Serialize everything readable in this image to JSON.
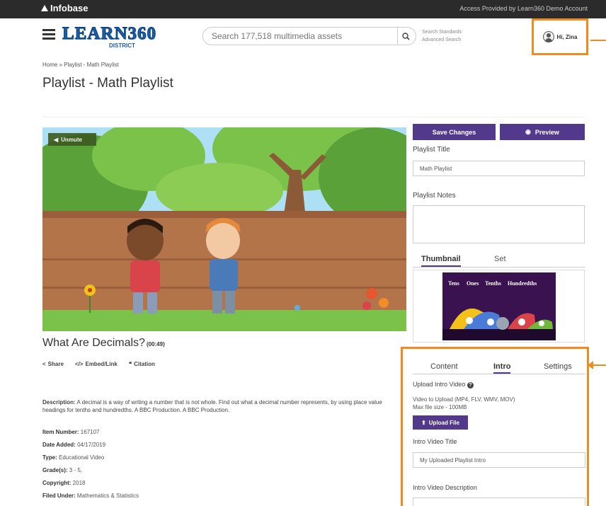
{
  "topbar": {
    "brand": "Infobase",
    "access": "Access Provided by Learn360 Demo Account"
  },
  "header": {
    "logo_word": "LEARN360",
    "logo_sub": "DISTRICT",
    "search_placeholder": "Search 177,518 multimedia assets",
    "standards_link": "Search Standards",
    "advanced_link": "Advanced Search",
    "greeting": "Hi, Zina"
  },
  "breadcrumb": "Home » Playlist - Math Playlist",
  "page_title": "Playlist - Math Playlist",
  "video": {
    "unmute_label": "Unmute",
    "title": "What Are Decimals?",
    "duration": "(00:49)",
    "actions": {
      "share": "Share",
      "embed": "Embed/Link",
      "citation": "Citation"
    }
  },
  "description": {
    "label": "Description:",
    "text": "A decimal is a way of writing a number that is not whole. Find out what a decimal number represents, by using place value headings for tenths and hundredths. A BBC Production. A BBC Production."
  },
  "meta": [
    {
      "label": "Item Number:",
      "value": "167107"
    },
    {
      "label": "Date Added:",
      "value": "04/17/2019"
    },
    {
      "label": "Type:",
      "value": "Educational Video"
    },
    {
      "label": "Grade(s):",
      "value": "3 - 5,"
    },
    {
      "label": "Copyright:",
      "value": "2018"
    },
    {
      "label": "Filed Under:",
      "value": "Mathematics & Statistics"
    }
  ],
  "sidebar": {
    "save_label": "Save Changes",
    "preview_label": "Preview",
    "playlist_title_label": "Playlist Title",
    "playlist_title_value": "Math Playlist",
    "playlist_notes_label": "Playlist Notes",
    "tab_thumbnail": "Thumbnail",
    "tab_set": "Set",
    "thumb_headings": [
      "Tens",
      "Ones",
      "Tenths",
      "Hundredths"
    ]
  },
  "panel": {
    "tabs": [
      "Content",
      "Intro",
      "Settings"
    ],
    "active_tab": "Intro",
    "upload_heading": "Upload Intro Video",
    "upload_formats": "Video to Upload (MP4, FLV, WMV, MOV)",
    "max_size": "Max file size - 100MB",
    "upload_button": "Upload File",
    "intro_title_label": "Intro Video Title",
    "intro_title_value": "My Uploaded Playlist Intro",
    "intro_desc_label": "Intro Video Description"
  },
  "colors": {
    "accent_purple": "#52398c",
    "highlight_orange": "#ef8b1f",
    "topbar": "#2b2b2b"
  }
}
